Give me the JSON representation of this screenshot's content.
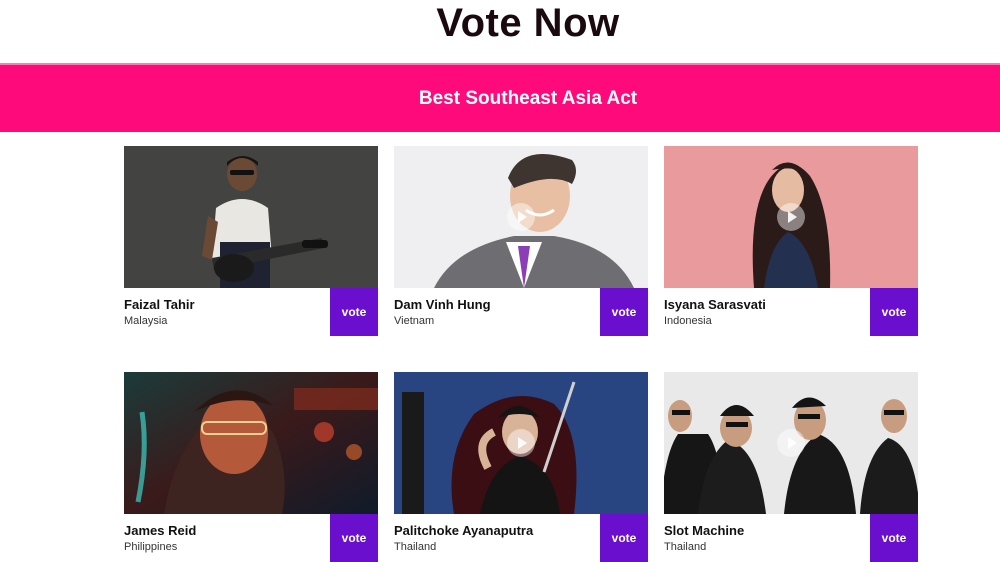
{
  "page": {
    "title": "Vote Now"
  },
  "category": {
    "title": "Best Southeast Asia Act",
    "accent": "#ff0a7a",
    "vote_button_color": "#6a0fce"
  },
  "nominees": [
    {
      "name": "Faizal Tahir",
      "country": "Malaysia",
      "vote_label": "vote",
      "has_play": false
    },
    {
      "name": "Dam Vinh Hung",
      "country": "Vietnam",
      "vote_label": "vote",
      "has_play": true
    },
    {
      "name": "Isyana Sarasvati",
      "country": "Indonesia",
      "vote_label": "vote",
      "has_play": true
    },
    {
      "name": "James Reid",
      "country": "Philippines",
      "vote_label": "vote",
      "has_play": false
    },
    {
      "name": "Palitchoke Ayanaputra",
      "country": "Thailand",
      "vote_label": "vote",
      "has_play": true
    },
    {
      "name": "Slot Machine",
      "country": "Thailand",
      "vote_label": "vote",
      "has_play": true
    }
  ]
}
